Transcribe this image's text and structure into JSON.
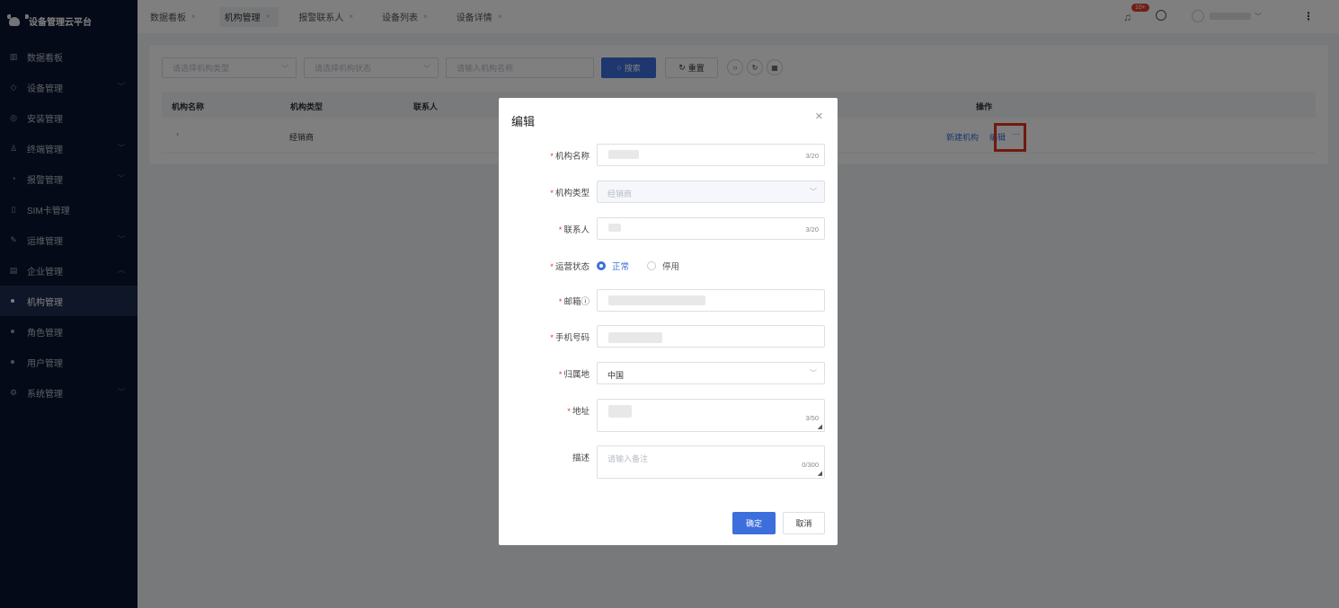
{
  "brand": {
    "title": "设备管理云平台"
  },
  "sidebar": {
    "items": [
      {
        "label": "数据看板",
        "icon": "bar-chart-icon",
        "has_arrow": false
      },
      {
        "label": "设备管理",
        "icon": "layers-icon",
        "has_arrow": true
      },
      {
        "label": "安装管理",
        "icon": "target-icon",
        "has_arrow": false
      },
      {
        "label": "终端管理",
        "icon": "user-icon",
        "has_arrow": true
      },
      {
        "label": "报警管理",
        "icon": "alarm-icon",
        "has_arrow": true
      },
      {
        "label": "SIM卡管理",
        "icon": "sim-card-icon",
        "has_arrow": false
      },
      {
        "label": "运维管理",
        "icon": "wrench-icon",
        "has_arrow": true
      },
      {
        "label": "企业管理",
        "icon": "building-icon",
        "has_arrow": true,
        "expanded": true
      }
    ],
    "sub_items": [
      {
        "label": "机构管理",
        "active": true
      },
      {
        "label": "角色管理",
        "active": false
      },
      {
        "label": "用户管理",
        "active": false
      }
    ],
    "last_item": {
      "label": "系统管理",
      "icon": "settings-icon"
    }
  },
  "tabs": [
    {
      "label": "数据看板",
      "active": false
    },
    {
      "label": "机构管理",
      "active": true
    },
    {
      "label": "报警联系人",
      "active": false
    },
    {
      "label": "设备列表",
      "active": false
    },
    {
      "label": "设备详情",
      "active": false
    }
  ],
  "header": {
    "notification_badge": "10+"
  },
  "filters": {
    "type_placeholder": "请选择机构类型",
    "status_placeholder": "请选择机构状态",
    "name_placeholder": "请输入机构名称",
    "search_label": "搜索",
    "reset_label": "重置"
  },
  "table": {
    "columns": [
      "机构名称",
      "机构类型",
      "联系人",
      "操作"
    ],
    "rows": [
      {
        "type": "经销商",
        "actions": [
          "新建机构",
          "编辑",
          "···"
        ]
      }
    ]
  },
  "modal": {
    "title": "编辑",
    "fields": {
      "name": {
        "label": "机构名称",
        "count": "3/20"
      },
      "org_type": {
        "label": "机构类型",
        "value": "经销商"
      },
      "contact": {
        "label": "联系人",
        "count": "3/20"
      },
      "status": {
        "label": "运营状态",
        "options": [
          "正常",
          "停用"
        ],
        "selected": "正常"
      },
      "email": {
        "label": "邮箱ⓘ"
      },
      "phone": {
        "label": "手机号码"
      },
      "region": {
        "label": "归属地",
        "value": "中国"
      },
      "address": {
        "label": "地址",
        "count": "3/50"
      },
      "desc": {
        "label": "描述",
        "placeholder": "请输入备注",
        "count": "0/300"
      }
    },
    "ok_label": "确定",
    "cancel_label": "取消"
  },
  "colors": {
    "primary": "#3d6fdc",
    "sidebar_bg": "#0b1530",
    "highlight": "#e5331f",
    "badge": "#e33c2c"
  }
}
